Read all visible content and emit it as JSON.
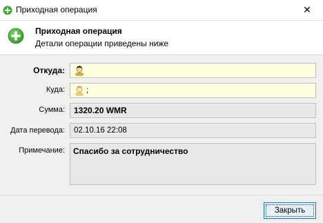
{
  "window": {
    "title": "Приходная операция",
    "close_glyph": "✕"
  },
  "header": {
    "title": "Приходная операция",
    "subtitle": "Детали операции приведены ниже",
    "icon": "plus-circle-icon"
  },
  "form": {
    "from_label": "Откуда:",
    "from_value": "",
    "to_label": "Куда:",
    "to_value": ";",
    "amount_label": "Сумма:",
    "amount_value": "1320.20 WMR",
    "date_label": "Дата перевода:",
    "date_value": "02.10.16 22:08",
    "note_label": "Примечание:",
    "note_value": "Спасибо за сотрудничество"
  },
  "footer": {
    "close_label": "Закрыть"
  },
  "colors": {
    "accent": "#0078d7",
    "field_yellow": "#ffffe1",
    "field_gray": "#e8e8e8",
    "icon_green": "#3faa35"
  }
}
